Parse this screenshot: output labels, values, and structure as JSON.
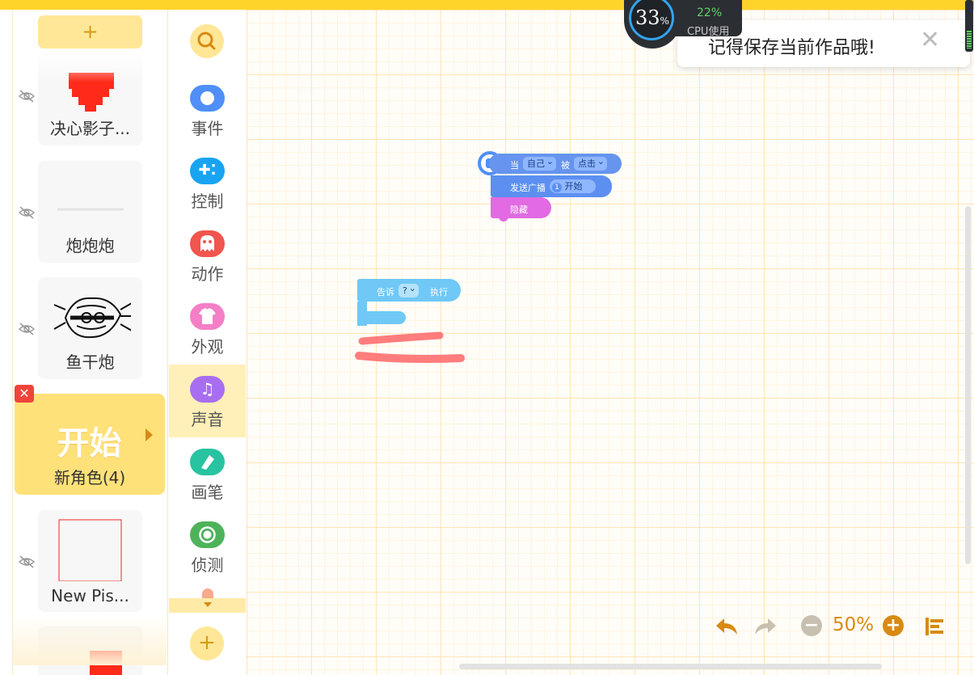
{
  "toolbar": {
    "add_label": "+"
  },
  "sprites": [
    {
      "name": "决心影子..."
    },
    {
      "name": "炮炮炮"
    },
    {
      "name": "鱼干炮"
    },
    {
      "name": "新角色(4)",
      "thumb_text": "开始"
    },
    {
      "name": "New Pis..."
    }
  ],
  "sprite_delete": "✕",
  "categories": [
    {
      "label": "事件",
      "color": "#4f8ff7"
    },
    {
      "label": "控制",
      "color": "#18a4f2"
    },
    {
      "label": "动作",
      "color": "#f0554e"
    },
    {
      "label": "外观",
      "color": "#f57fc7"
    },
    {
      "label": "声音",
      "color": "#a86ef2"
    },
    {
      "label": "画笔",
      "color": "#28c3a0"
    },
    {
      "label": "侦测",
      "color": "#4db35a"
    }
  ],
  "category_add": "+",
  "blocks": {
    "event": {
      "when": "当",
      "target": "自己",
      "by": "被",
      "action": "点击"
    },
    "broadcast": {
      "label": "发送广播",
      "num": "1",
      "msg": "开始"
    },
    "hide": {
      "label": "隐藏"
    },
    "tell": {
      "label": "告诉",
      "target": "?",
      "exec": "执行"
    }
  },
  "toast": {
    "message": "记得保存当前作品哦!",
    "close": "✕"
  },
  "cpu": {
    "percent": "33",
    "unit": "%",
    "memory": "22%",
    "caption": "CPU使用"
  },
  "zoom": {
    "value": "50%",
    "minus": "−",
    "plus": "+"
  },
  "colors": {
    "accent": "#ffd42a",
    "orange": "#d88a12",
    "event_blue": "#4f8ff7",
    "control_cyan": "#6fc8f5",
    "looks_pink": "#e26ae2"
  }
}
